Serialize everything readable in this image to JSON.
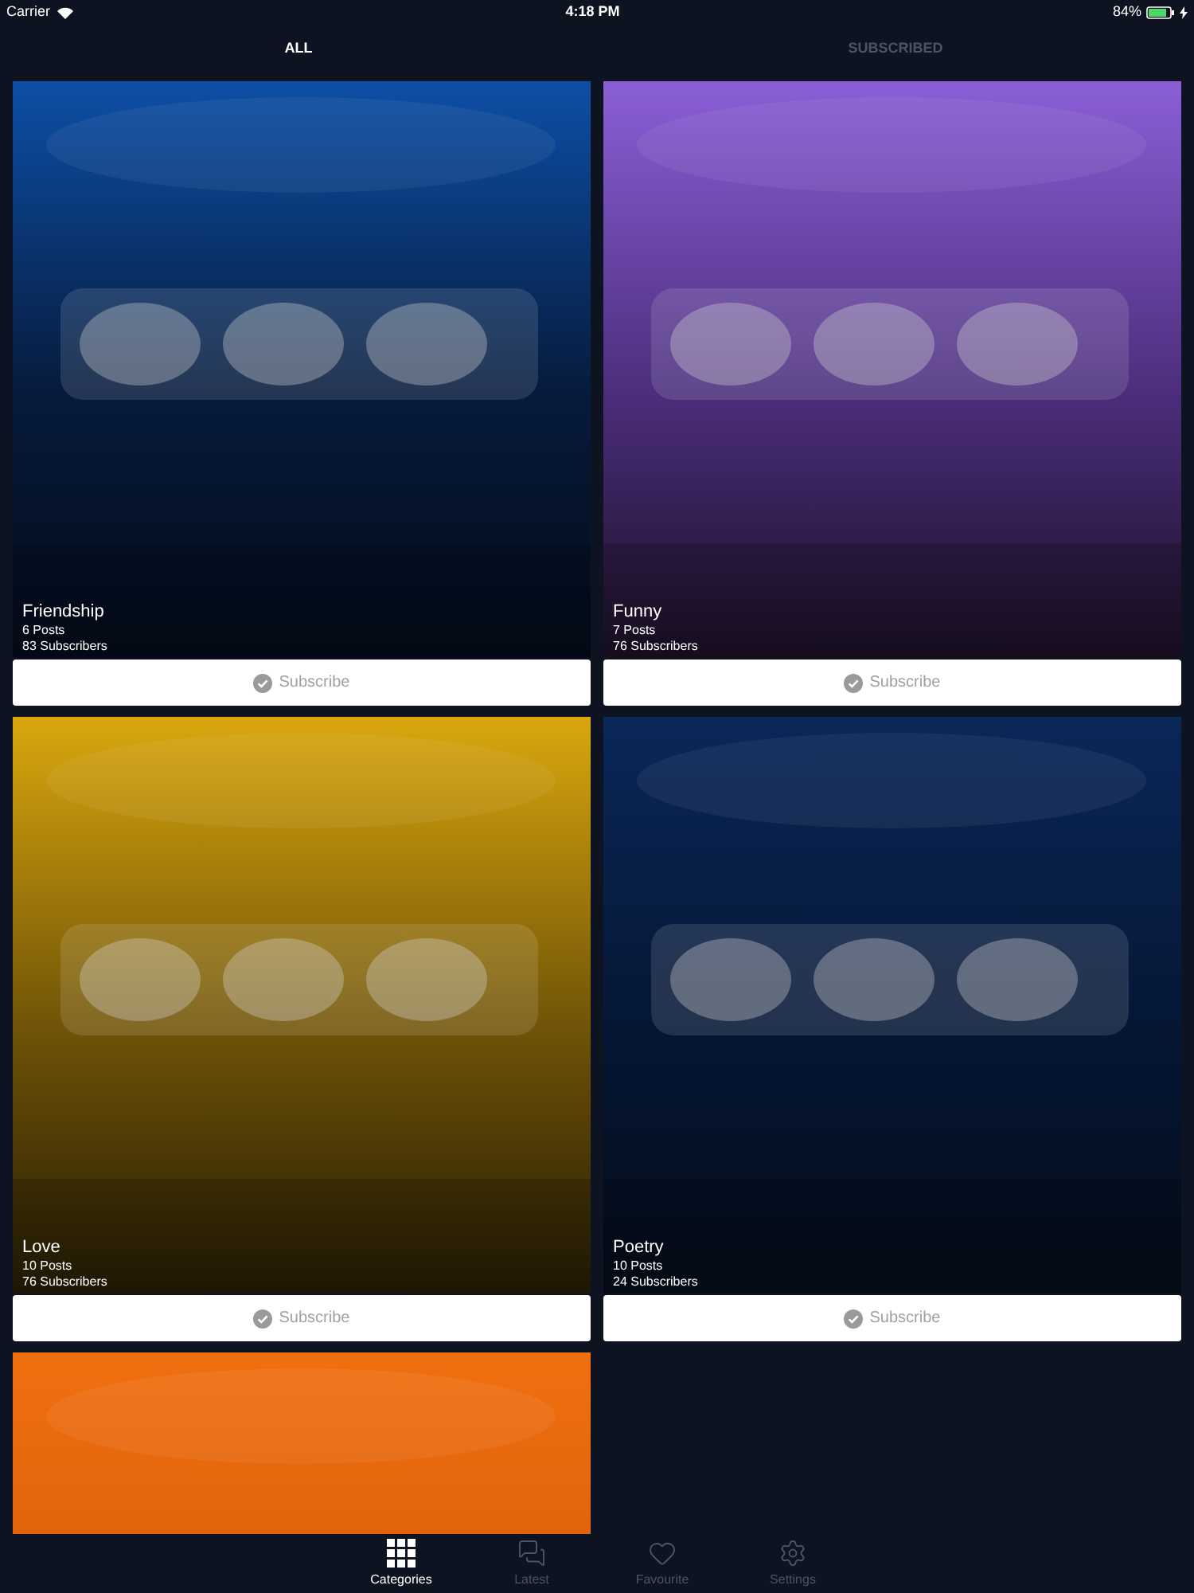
{
  "status_bar": {
    "carrier": "Carrier",
    "time": "4:18 PM",
    "battery": "84%",
    "charging": true
  },
  "tabs": [
    {
      "label": "ALL",
      "selected": true
    },
    {
      "label": "SUBSCRIBED",
      "selected": false
    }
  ],
  "categories": [
    {
      "kind": "card",
      "title": "Friendship",
      "posts": "6 Posts",
      "subscribers": "83 Subscribers",
      "button": "Subscribe",
      "subscribed": false
    },
    {
      "kind": "card",
      "title": "Funny",
      "posts": "7 Posts",
      "subscribers": "76 Subscribers",
      "button": "Subscribe",
      "subscribed": false
    },
    {
      "kind": "card",
      "title": "Love",
      "posts": "10 Posts",
      "subscribers": "76 Subscribers",
      "button": "Subscribe",
      "subscribed": false
    },
    {
      "kind": "card",
      "title": "Poetry",
      "posts": "10 Posts",
      "subscribers": "24 Subscribers",
      "button": "Subscribe",
      "subscribed": false
    },
    {
      "kind": "picture"
    }
  ],
  "tab_bar": [
    {
      "label": "Categories",
      "selected": true
    },
    {
      "label": "Latest",
      "selected": false
    },
    {
      "label": "Favourite",
      "selected": false
    },
    {
      "label": "Settings",
      "selected": false
    }
  ]
}
